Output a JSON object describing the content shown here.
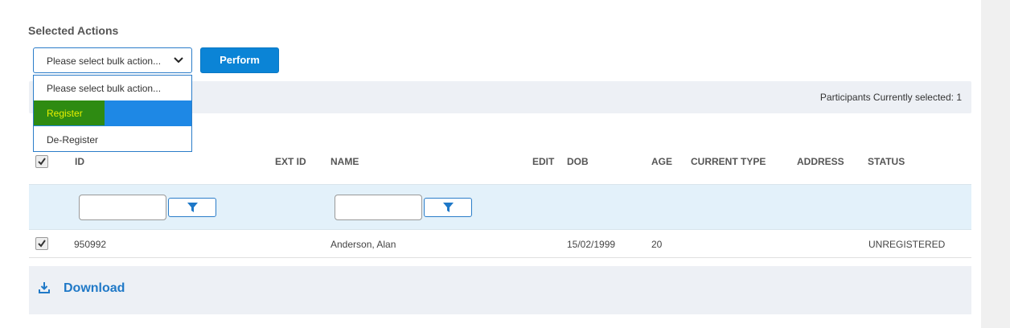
{
  "section_title": "Selected Actions",
  "bulk_action": {
    "selected": "Please select bulk action...",
    "options": [
      "Please select bulk action...",
      "Register",
      "De-Register"
    ],
    "highlighted_option": "Register"
  },
  "perform_label": "Perform",
  "selection_info": "Participants Currently selected: 1",
  "table": {
    "headers": {
      "id": "ID",
      "ext_id": "EXT ID",
      "name": "NAME",
      "edit": "EDIT",
      "dob": "DOB",
      "age": "AGE",
      "current_type": "CURRENT TYPE",
      "address": "ADDRESS",
      "status": "STATUS"
    },
    "select_all_checked": true,
    "rows": [
      {
        "checked": true,
        "id": "950992",
        "ext_id": "",
        "name": "Anderson, Alan",
        "dob": "15/02/1999",
        "age": "20",
        "current_type": "",
        "address": "",
        "status": "UNREGISTERED"
      }
    ]
  },
  "download_label": "Download",
  "colors": {
    "accent": "#0b84d6",
    "dropdown_highlight": "#1e88e5",
    "marker_green": "#2e8b12",
    "marker_text": "#e8f000",
    "filter_row_bg": "#e3f1fa",
    "bar_bg": "#edf0f5"
  },
  "icons": {
    "select_chevron": "chevron-down-icon",
    "filter": "filter-icon",
    "checkbox": "checkmark-icon",
    "download": "download-icon"
  }
}
